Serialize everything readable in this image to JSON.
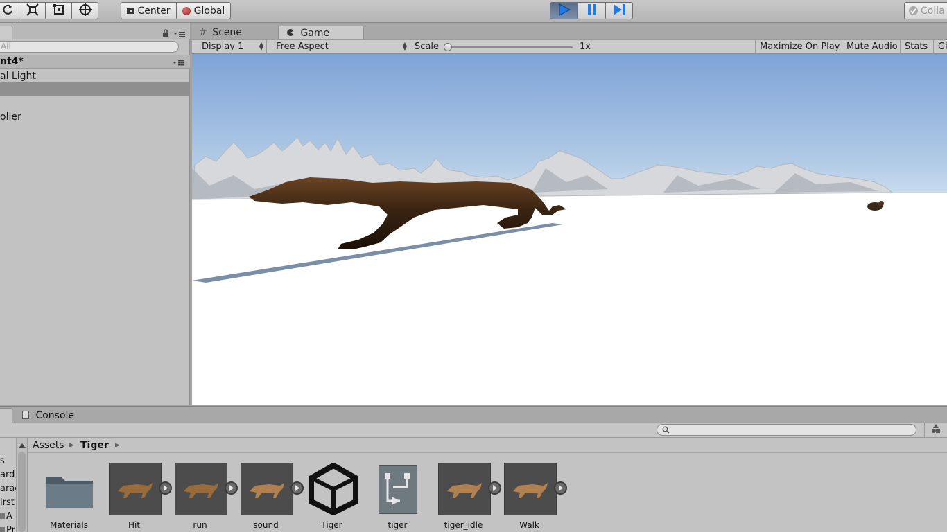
{
  "toolbar": {
    "pivot_label": "Center",
    "space_label": "Global",
    "collab_label": "Colla"
  },
  "hierarchy": {
    "search_placeholder": "All",
    "scene_name": "nt4*",
    "items": [
      "al Light",
      "",
      "",
      "oller"
    ]
  },
  "views": {
    "scene_tab": "Scene",
    "game_tab": "Game"
  },
  "gamebar": {
    "display": "Display 1",
    "aspect": "Free Aspect",
    "scale_label": "Scale",
    "scale_value": "1x",
    "maximize": "Maximize On Play",
    "mute": "Mute Audio",
    "stats": "Stats",
    "gizmos": "Gi"
  },
  "bottom": {
    "console_tab": "Console"
  },
  "project": {
    "breadcrumb_root": "Assets",
    "breadcrumb_current": "Tiger",
    "left_items": [
      "s",
      "ard",
      "arac",
      "irst",
      "A",
      "Pr"
    ],
    "assets": [
      {
        "label": "Materials",
        "kind": "folder"
      },
      {
        "label": "Hit",
        "kind": "animation"
      },
      {
        "label": "run",
        "kind": "animation"
      },
      {
        "label": "sound",
        "kind": "animation"
      },
      {
        "label": "Tiger",
        "kind": "unity-logo"
      },
      {
        "label": "tiger",
        "kind": "avatar"
      },
      {
        "label": "tiger_idle",
        "kind": "animation"
      },
      {
        "label": "Walk",
        "kind": "animation"
      }
    ]
  },
  "colors": {
    "sky_top": "#7ea3d6",
    "sky_horizon": "#cfe0f0",
    "snow": "#ffffff",
    "play_active": "#1e7be8",
    "tiger_body": "#2e1d10"
  }
}
